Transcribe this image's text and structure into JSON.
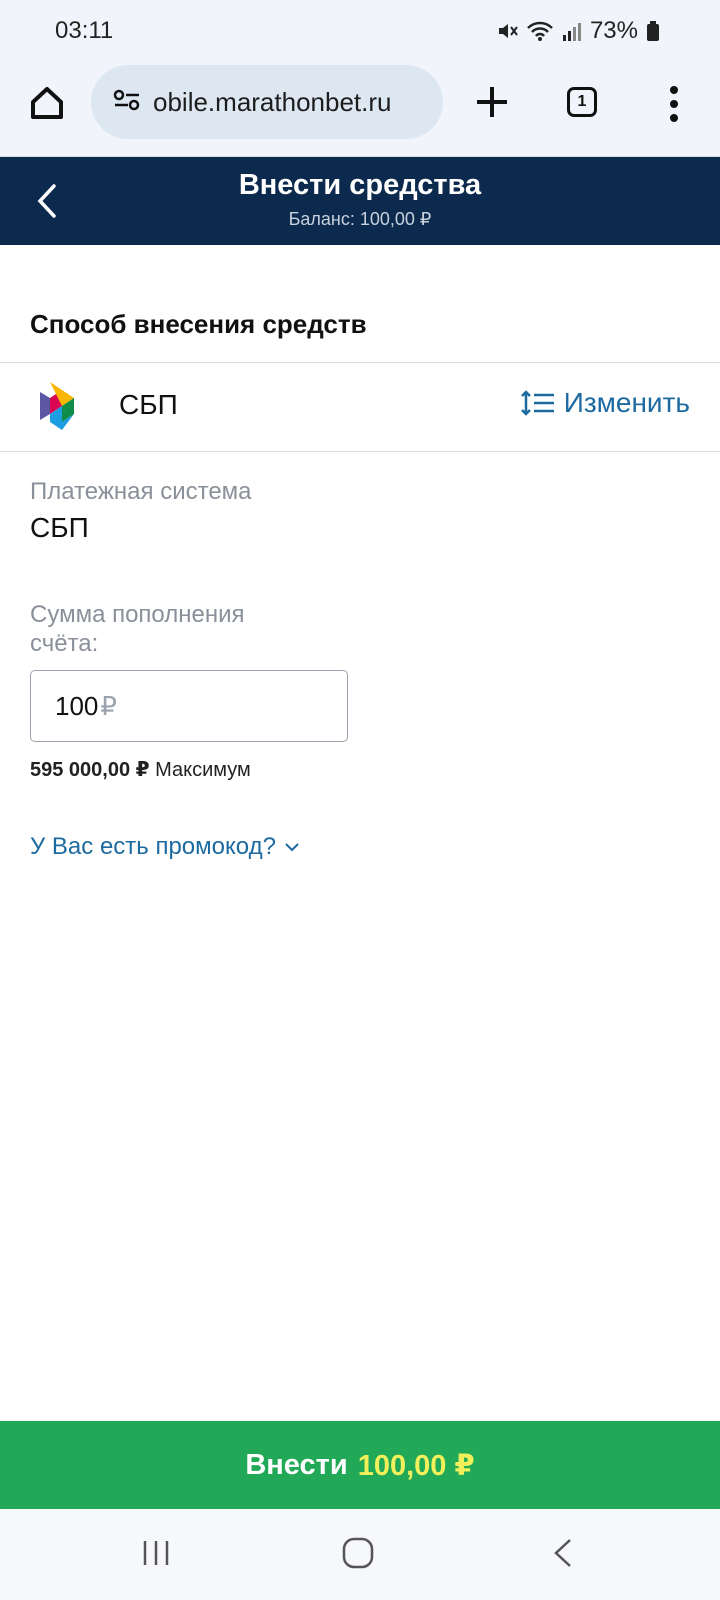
{
  "status_bar": {
    "time": "03:11",
    "battery": "73%",
    "icons": [
      "mute-icon",
      "wifi-icon",
      "signal-icon",
      "battery-icon"
    ]
  },
  "browser": {
    "url": "obile.marathonbet.ru",
    "tab_count": "1",
    "icons": [
      "home-icon",
      "site-settings-icon",
      "plus-icon",
      "tab-switcher-icon",
      "more-vert-icon"
    ]
  },
  "header": {
    "title": "Внести средства",
    "balance": "Баланс: 100,00 ₽"
  },
  "method": {
    "section_title": "Способ внесения средств",
    "name": "СБП",
    "change_label": "Изменить"
  },
  "payment_system": {
    "label": "Платежная система",
    "value": "СБП"
  },
  "amount": {
    "label": "Сумма пополнения счёта:",
    "value": "100",
    "currency": "₽",
    "max_value": "595 000,00 ₽",
    "max_label": "Максимум"
  },
  "promo": {
    "label": "У Вас есть промокод?"
  },
  "deposit_button": {
    "label": "Внести",
    "amount": "100,00 ₽"
  },
  "colors": {
    "header_bg": "#0c2a4d",
    "link": "#1d6aa0",
    "button_bg": "#21a957",
    "button_amount": "#f1f05a"
  }
}
